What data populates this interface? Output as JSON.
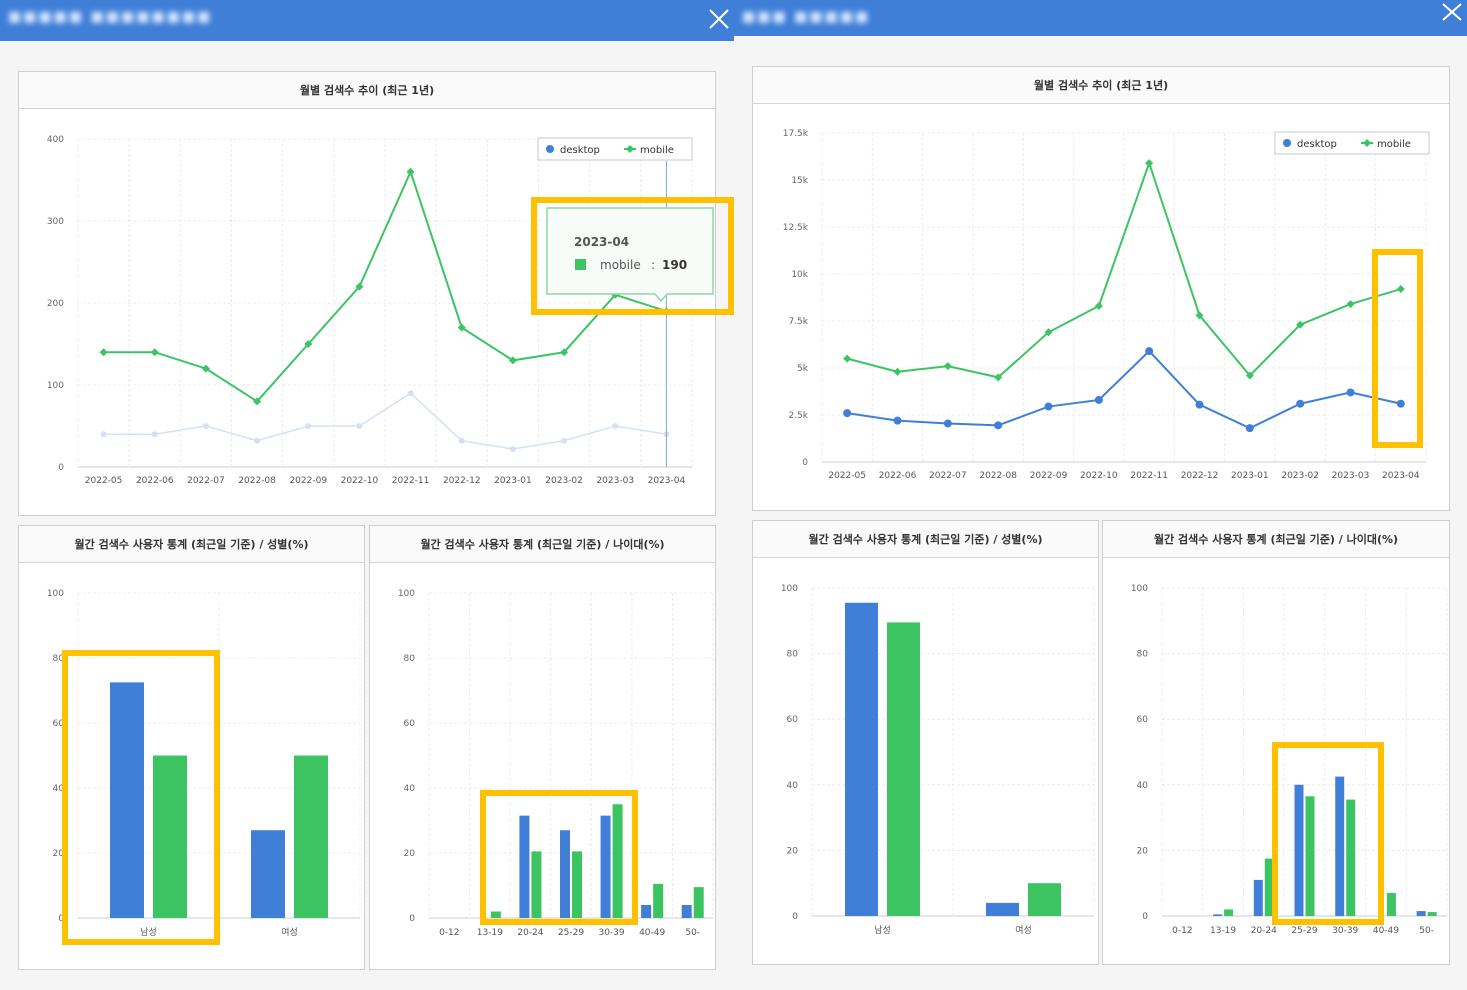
{
  "colors": {
    "titlebar": "#3f7fd8",
    "desktop": "#3f7fd8",
    "mobile": "#3cc463",
    "highlight": "#ffc000"
  },
  "left_popup": {
    "window_title": "■■■■■ ■■■■■■■■",
    "close_icon": "close-icon",
    "line_panel_title": "월별 검색수 추이 (최근 1년)",
    "gender_panel_title": "월간 검색수 사용자 통계 (최근일 기준) / 성별(%)",
    "age_panel_title": "월간 검색수 사용자 통계 (최근일 기준) / 나이대(%)",
    "tooltip": {
      "date": "2023-04",
      "series": "mobile",
      "value": "190"
    }
  },
  "right_popup": {
    "window_title": "■■■ ■■■■■",
    "close_icon": "close-icon",
    "line_panel_title": "월별 검색수 추이 (최근 1년)",
    "gender_panel_title": "월간 검색수 사용자 통계 (최근일 기준) / 성별(%)",
    "age_panel_title": "월간 검색수 사용자 통계 (최근일 기준) / 나이대(%)"
  },
  "chart_data": [
    {
      "type": "line",
      "title": "월별 검색수 추이 (최근 1년)",
      "categories": [
        "2022-05",
        "2022-06",
        "2022-07",
        "2022-08",
        "2022-09",
        "2022-10",
        "2022-11",
        "2022-12",
        "2023-01",
        "2023-02",
        "2023-03",
        "2023-04"
      ],
      "yticks": [
        0,
        100,
        200,
        300,
        400
      ],
      "ylim": [
        0,
        400
      ],
      "legend": "top-right",
      "grid": true,
      "series": [
        {
          "name": "desktop",
          "values": [
            40,
            40,
            50,
            32,
            50,
            50,
            90,
            32,
            22,
            32,
            50,
            40
          ],
          "faded": true
        },
        {
          "name": "mobile",
          "values": [
            140,
            140,
            120,
            80,
            150,
            220,
            360,
            170,
            130,
            140,
            210,
            190
          ]
        }
      ]
    },
    {
      "type": "bar",
      "title": "월간 검색수 사용자 통계 (최근일 기준) / 성별(%)",
      "categories": [
        "남성",
        "여성"
      ],
      "yticks": [
        0,
        20,
        40,
        60,
        80,
        100
      ],
      "ylim": [
        0,
        100
      ],
      "grid": true,
      "series": [
        {
          "name": "desktop",
          "values": [
            72.5,
            27
          ]
        },
        {
          "name": "mobile",
          "values": [
            50,
            50
          ]
        }
      ]
    },
    {
      "type": "bar",
      "title": "월간 검색수 사용자 통계 (최근일 기준) / 나이대(%)",
      "categories": [
        "0-12",
        "13-19",
        "20-24",
        "25-29",
        "30-39",
        "40-49",
        "50-"
      ],
      "yticks": [
        0,
        20,
        40,
        60,
        80,
        100
      ],
      "ylim": [
        0,
        100
      ],
      "grid": true,
      "series": [
        {
          "name": "desktop",
          "values": [
            0,
            0,
            31.5,
            27,
            31.5,
            4,
            4
          ]
        },
        {
          "name": "mobile",
          "values": [
            0,
            2,
            20.5,
            20.5,
            35,
            10.5,
            9.5
          ]
        }
      ]
    },
    {
      "type": "line",
      "title": "월별 검색수 추이 (최근 1년)",
      "categories": [
        "2022-05",
        "2022-06",
        "2022-07",
        "2022-08",
        "2022-09",
        "2022-10",
        "2022-11",
        "2022-12",
        "2023-01",
        "2023-02",
        "2023-03",
        "2023-04"
      ],
      "yticks": [
        "0",
        "2.5k",
        "5k",
        "7.5k",
        "10k",
        "12.5k",
        "15k",
        "17.5k"
      ],
      "ylim": [
        0,
        17500
      ],
      "legend": "top-right",
      "grid": true,
      "series": [
        {
          "name": "desktop",
          "values": [
            2600,
            2200,
            2050,
            1950,
            2950,
            3300,
            5900,
            3050,
            1800,
            3100,
            3700,
            3100
          ]
        },
        {
          "name": "mobile",
          "values": [
            5500,
            4800,
            5100,
            4500,
            6900,
            8300,
            15900,
            7800,
            4600,
            7300,
            8400,
            9200
          ]
        }
      ]
    },
    {
      "type": "bar",
      "title": "월간 검색수 사용자 통계 (최근일 기준) / 성별(%)",
      "categories": [
        "남성",
        "여성"
      ],
      "yticks": [
        0,
        20,
        40,
        60,
        80,
        100
      ],
      "ylim": [
        0,
        100
      ],
      "grid": true,
      "series": [
        {
          "name": "desktop",
          "values": [
            95.5,
            4
          ]
        },
        {
          "name": "mobile",
          "values": [
            89.5,
            10
          ]
        }
      ]
    },
    {
      "type": "bar",
      "title": "월간 검색수 사용자 통계 (최근일 기준) / 나이대(%)",
      "categories": [
        "0-12",
        "13-19",
        "20-24",
        "25-29",
        "30-39",
        "40-49",
        "50-"
      ],
      "yticks": [
        0,
        20,
        40,
        60,
        80,
        100
      ],
      "ylim": [
        0,
        100
      ],
      "grid": true,
      "series": [
        {
          "name": "desktop",
          "values": [
            0,
            0.5,
            11,
            40,
            42.5,
            0,
            1.5
          ]
        },
        {
          "name": "mobile",
          "values": [
            0,
            2,
            17.5,
            36.5,
            35.5,
            7,
            1.2
          ]
        }
      ]
    }
  ]
}
